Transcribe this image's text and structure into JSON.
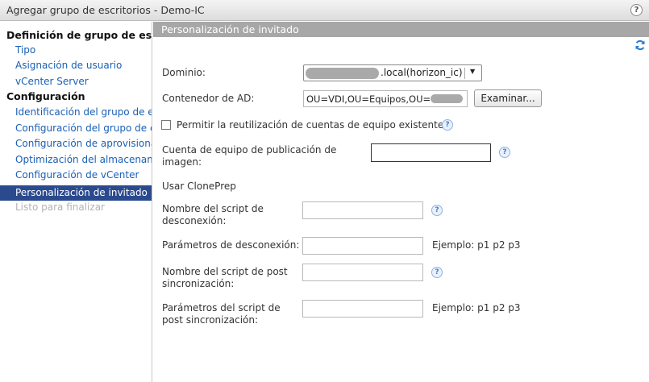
{
  "window": {
    "title": "Agregar grupo de escritorios - Demo-IC",
    "help_label": "?"
  },
  "sidebar": {
    "section1": "Definición de grupo de escritorios",
    "items1": [
      {
        "label": "Tipo"
      },
      {
        "label": "Asignación de usuario"
      },
      {
        "label": "vCenter Server"
      }
    ],
    "section2": "Configuración",
    "items2": [
      {
        "label": "Identificación del grupo de escritorios"
      },
      {
        "label": "Configuración del grupo de escritorios"
      },
      {
        "label": "Configuración de aprovisionamiento"
      },
      {
        "label": "Optimización del almacenamiento"
      },
      {
        "label": "Configuración de vCenter"
      },
      {
        "label": "Personalización de invitado",
        "active": true
      },
      {
        "label": "Listo para finalizar",
        "disabled": true
      }
    ]
  },
  "main": {
    "section_title": "Personalización de invitado",
    "domain": {
      "label": "Dominio:",
      "value": ".local(horizon_ic)"
    },
    "ad_container": {
      "label": "Contenedor de AD:",
      "value": "OU=VDI,OU=Equipos,OU=",
      "button": "Examinar..."
    },
    "reuse_accounts": {
      "label": "Permitir la reutilización de cuentas de equipo existentes",
      "checked": false
    },
    "publish_account": {
      "label": "Cuenta de equipo de publicación de imagen:",
      "value": ""
    },
    "cloneprep_label": "Usar ClonePrep",
    "poweroff_script": {
      "label": "Nombre del script de desconexión:",
      "value": ""
    },
    "poweroff_params": {
      "label": "Parámetros de desconexión:",
      "value": "",
      "example": "Ejemplo: p1 p2 p3"
    },
    "postsync_script": {
      "label": "Nombre del script de post sincronización:",
      "value": ""
    },
    "postsync_params": {
      "label": "Parámetros del script de post sincronización:",
      "value": "",
      "example": "Ejemplo: p1 p2 p3"
    },
    "help_label": "?"
  },
  "colors": {
    "active_bg": "#2b4a8e",
    "link": "#1a5fb4",
    "section_bar": "#a7a7a7"
  }
}
